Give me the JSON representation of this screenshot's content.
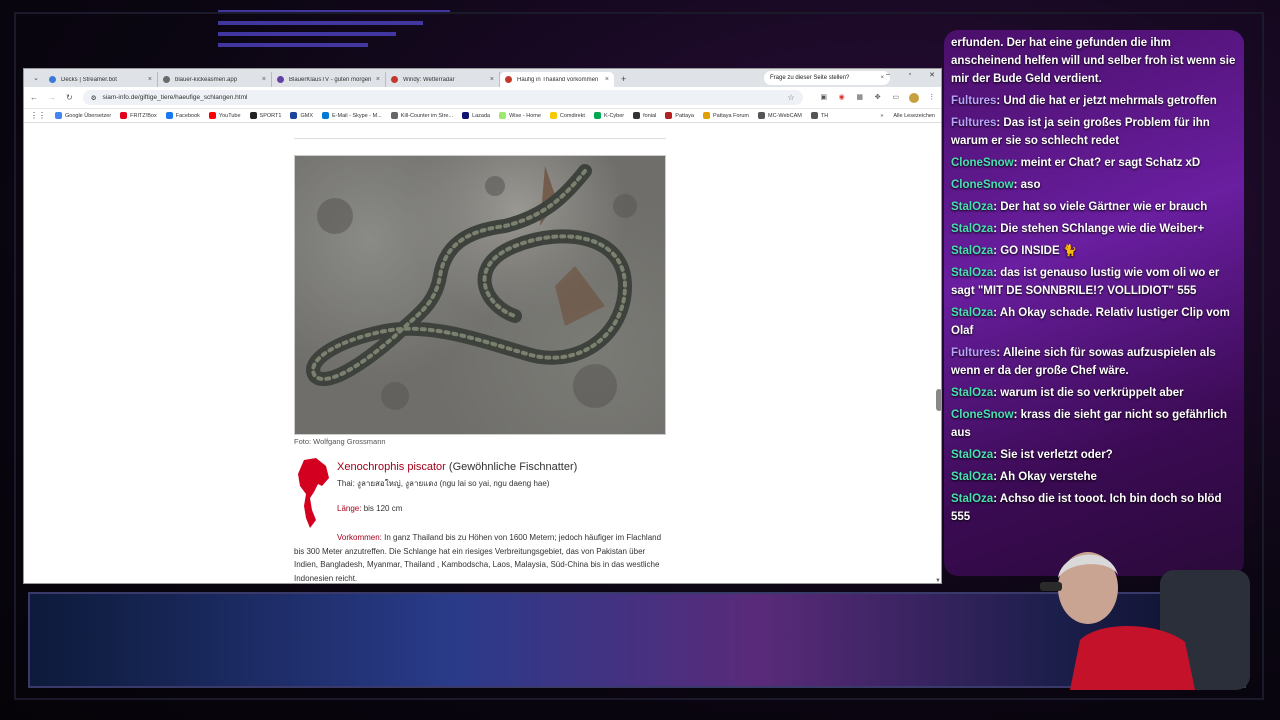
{
  "browser": {
    "tabs": [
      {
        "title": "Decks | Streamer.bot",
        "fav": "#3b7bd8"
      },
      {
        "title": "blauer-kickeasmen.app",
        "fav": "#6a6a6a"
      },
      {
        "title": "BlauerKlausTV - guten morgen",
        "fav": "#6441a5"
      },
      {
        "title": "Windy: Wetterradar",
        "fav": "#c0392b"
      },
      {
        "title": "Häufig in Thailand vorkommen",
        "fav": "#c0392b"
      }
    ],
    "ask": "Frage zu dieser Seite stellen?",
    "url": "siam-info.de/giftige_tiere/haeufige_schlangen.html",
    "bookmarks": [
      {
        "label": "Google Übersetzer",
        "color": "#4285f4"
      },
      {
        "label": "FRITZ!Box",
        "color": "#e2001a"
      },
      {
        "label": "Facebook",
        "color": "#1877f2"
      },
      {
        "label": "YouTube",
        "color": "#ff0000"
      },
      {
        "label": "SPORT1",
        "color": "#222222"
      },
      {
        "label": "GMX",
        "color": "#1c449b"
      },
      {
        "label": "E-Mail - Skype - M...",
        "color": "#0078d4"
      },
      {
        "label": "Kill-Counter im Stre...",
        "color": "#666666"
      },
      {
        "label": "Lazada",
        "color": "#0f146d"
      },
      {
        "label": "Wise - Home",
        "color": "#9fe870"
      },
      {
        "label": "Comdirekt",
        "color": "#f7c900"
      },
      {
        "label": "K-Cyber",
        "color": "#00a950"
      },
      {
        "label": "fonial",
        "color": "#333333"
      },
      {
        "label": "Pattaya",
        "color": "#b22222"
      },
      {
        "label": "Pattaya Forum",
        "color": "#e0a100"
      },
      {
        "label": "MC-WebCAM",
        "color": "#555555"
      },
      {
        "label": "TH",
        "color": "#555555"
      }
    ],
    "bookmarks_right": "Alle Lesezeichen"
  },
  "page": {
    "caption": "Foto: Wolfgang Grossmann",
    "species_sci": "Xenochrophis piscator",
    "species_common": "(Gewöhnliche Fischnatter)",
    "thai_label": "Thai:",
    "thai_value": "งูลายสอใหญ่, งูลายแดง (ngu lai so yai, ngu daeng hae)",
    "length_label": "Länge:",
    "length_value": "bis 120 cm",
    "vork_label": "Vorkommen:",
    "vork_text": "In ganz Thailand bis zu Höhen von 1600 Metern; jedoch häufiger im Flachland bis 300 Meter anzutreffen. Die Schlange hat ein riesiges Verbreitungsgebiet, das von Pakistan über Indien, Bangladesh, Myanmar, Thailand , Kambodscha, Laos, Malaysia, Süd-China bis in das westliche Indonesien reicht."
  },
  "chat": {
    "messages": [
      {
        "user": "",
        "text": "erfunden. Der hat eine gefunden die ihm anscheinend helfen will und selber froh ist wenn sie mir der Bude Geld verdient."
      },
      {
        "user": "Fultures",
        "text": ": Und die hat er jetzt mehrmals getroffen",
        "f": true
      },
      {
        "user": "Fultures",
        "text": ": Das ist ja sein großes Problem für ihn warum er sie so schlecht redet",
        "f": true
      },
      {
        "user": "CloneSnow",
        "text": ": meint er Chat? er sagt Schatz xD"
      },
      {
        "user": "CloneSnow",
        "text": ": aso"
      },
      {
        "user": "StalOza",
        "text": ": Der hat so viele Gärtner wie er brauch"
      },
      {
        "user": "StalOza",
        "text": ": Die stehen SChlange wie die Weiber+"
      },
      {
        "user": "StalOza",
        "text": ": GO INSIDE 🐈"
      },
      {
        "user": "StalOza",
        "text": ": das ist genauso lustig wie vom oli wo er sagt \"MIT DE SONNBRILE!? VOLLIDIOT\" 555"
      },
      {
        "user": "StalOza",
        "text": ": Ah Okay schade. Relativ lustiger Clip vom Olaf"
      },
      {
        "user": "Fultures",
        "text": ": Alleine sich für sowas aufzuspielen als wenn er da der große Chef wäre.",
        "f": true
      },
      {
        "user": "StalOza",
        "text": ": warum ist die so verkrüppelt aber"
      },
      {
        "user": "CloneSnow",
        "text": ": krass die sieht gar nicht so gefährlich aus"
      },
      {
        "user": "StalOza",
        "text": ": Sie ist verletzt oder?"
      },
      {
        "user": "StalOza",
        "text": ": Ah Okay verstehe"
      },
      {
        "user": "StalOza",
        "text": ": Achso die ist tooot. Ich bin doch so blöd 555"
      }
    ]
  }
}
